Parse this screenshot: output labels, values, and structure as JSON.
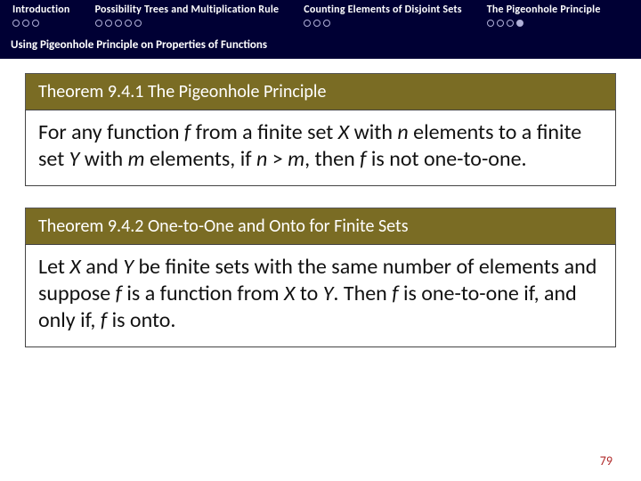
{
  "nav": {
    "items": [
      {
        "label": "Introduction",
        "dots": 3,
        "filled": -1
      },
      {
        "label": "Possibility Trees and Multiplication Rule",
        "dots": 5,
        "filled": -1
      },
      {
        "label": "Counting Elements of Disjoint Sets",
        "dots": 3,
        "filled": -1
      },
      {
        "label": "The Pigeonhole Principle",
        "dots": 4,
        "filled": 3
      }
    ],
    "subhead": "Using Pigeonhole Principle on Properties of Functions"
  },
  "theorems": [
    {
      "title": "Theorem 9.4.1 The Pigeonhole Principle",
      "body_html": "For any function <span class='i'>f</span> from a finite set <span class='i'>X</span> with <span class='i'>n</span> elements to a finite set <span class='i'>Y</span> with <span class='i'>m</span> elements, if <span class='i'>n</span> &gt; <span class='i'>m</span>, then <span class='i'>f</span> is not one-to-one."
    },
    {
      "title": "Theorem 9.4.2 One-to-One and Onto for Finite Sets",
      "body_html": "Let <span class='i'>X</span> and <span class='i'>Y</span> be finite sets with the same number of elements and suppose <span class='i'>f</span> is a function from <span class='i'>X</span> to <span class='i'>Y</span>. Then <span class='i'>f</span> is one-to-one if, and only if, <span class='i'>f</span> is onto."
    }
  ],
  "page_number": "79"
}
